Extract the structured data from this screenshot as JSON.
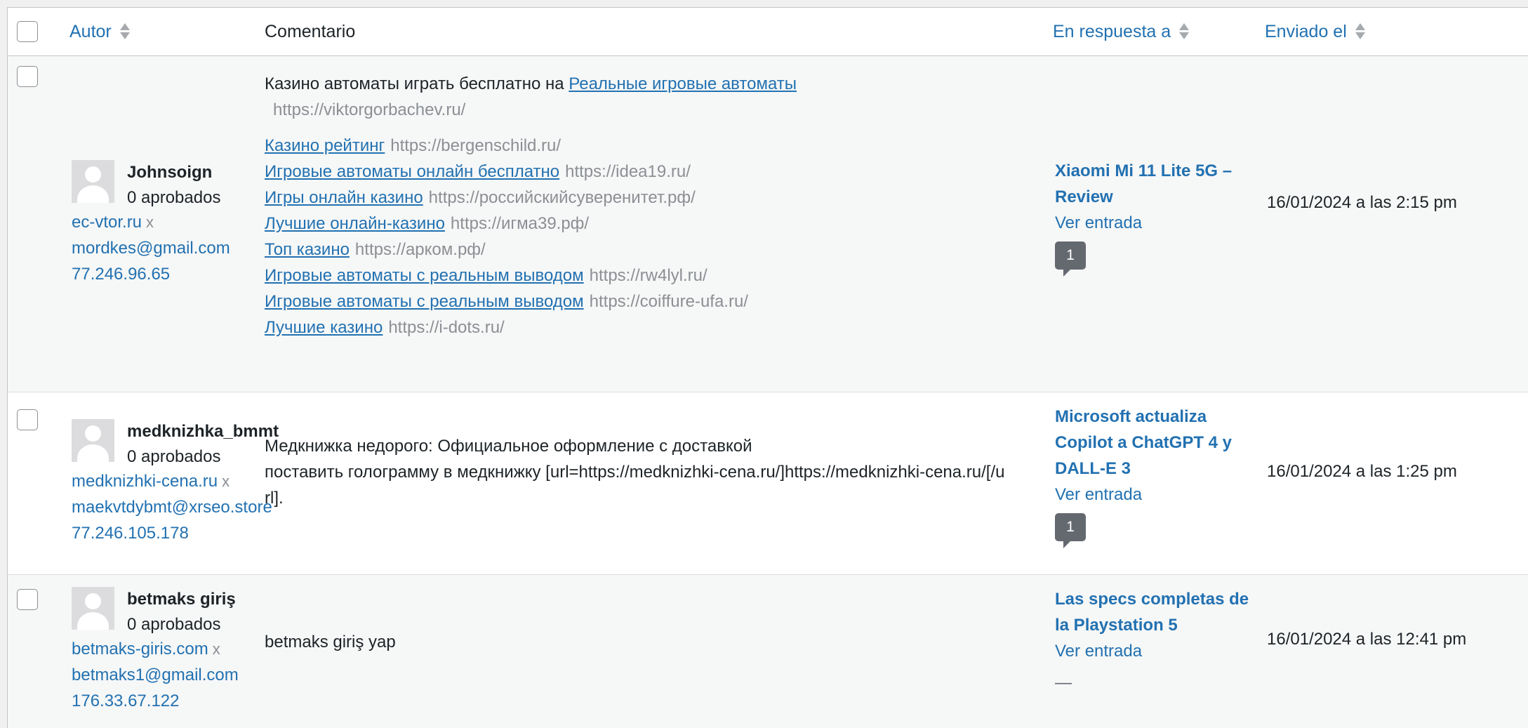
{
  "header": {
    "author": "Autor",
    "comment": "Comentario",
    "in_response_to": "En respuesta a",
    "submitted_on": "Enviado el"
  },
  "comments": [
    {
      "author_name": "Johnsoign",
      "approved": "0 aprobados",
      "site": "ec-vtor.ru",
      "x": "x",
      "email": "mordkes@gmail.com",
      "ip": "77.246.96.65",
      "intro_text": "Казино автоматы играть бесплатно на ",
      "intro_link": "Реальные игровые автоматы",
      "intro_url": "https://viktorgorbachev.ru/",
      "links": [
        {
          "label": "Казино рейтинг",
          "url": "https://bergenschild.ru/"
        },
        {
          "label": "Игровые автоматы онлайн бесплатно",
          "url": "https://idea19.ru/"
        },
        {
          "label": "Игры онлайн казино",
          "url": "https://российскийсуверенитет.рф/"
        },
        {
          "label": "Лучшие онлайн-казино",
          "url": "https://игма39.рф/"
        },
        {
          "label": "Топ казино",
          "url": "https://арком.рф/"
        },
        {
          "label": "Игровые автоматы с реальным выводом",
          "url": "https://rw4lyl.ru/"
        },
        {
          "label": "Игровые автоматы с реальным выводом",
          "url": "https://coiffure-ufa.ru/"
        },
        {
          "label": "Лучшие казино",
          "url": "https://i-dots.ru/"
        }
      ],
      "post_title": "Xiaomi Mi 11 Lite 5G – Review",
      "view_post": "Ver entrada",
      "count": "1",
      "date": "16/01/2024 a las 2:15 pm"
    },
    {
      "author_name": "medknizhka_bmmt",
      "approved": "0 aprobados",
      "site": "medknizhki-cena.ru",
      "x": "x",
      "email": "maekvtdybmt@xrseo.store",
      "ip": "77.246.105.178",
      "text_line1": "Медкнижка недорого: Официальное оформление с доставкой",
      "text_line2": "поставить голограмму в медкнижку [url=https://medknizhki-cena.ru/]https://medknizhki-cena.ru/[/url].",
      "post_title": "Microsoft actualiza Copilot a ChatGPT 4 y DALL-E 3",
      "view_post": "Ver entrada",
      "count": "1",
      "date": "16/01/2024 a las 1:25 pm"
    },
    {
      "author_name": "betmaks giriş",
      "approved": "0 aprobados",
      "site": "betmaks-giris.com",
      "x": "x",
      "email": "betmaks1@gmail.com",
      "ip": "176.33.67.122",
      "text": "betmaks giriş yap",
      "post_title": "Las specs completas de la Playstation 5",
      "view_post": "Ver entrada",
      "dash": "—",
      "date": "16/01/2024 a las 12:41 pm"
    }
  ]
}
